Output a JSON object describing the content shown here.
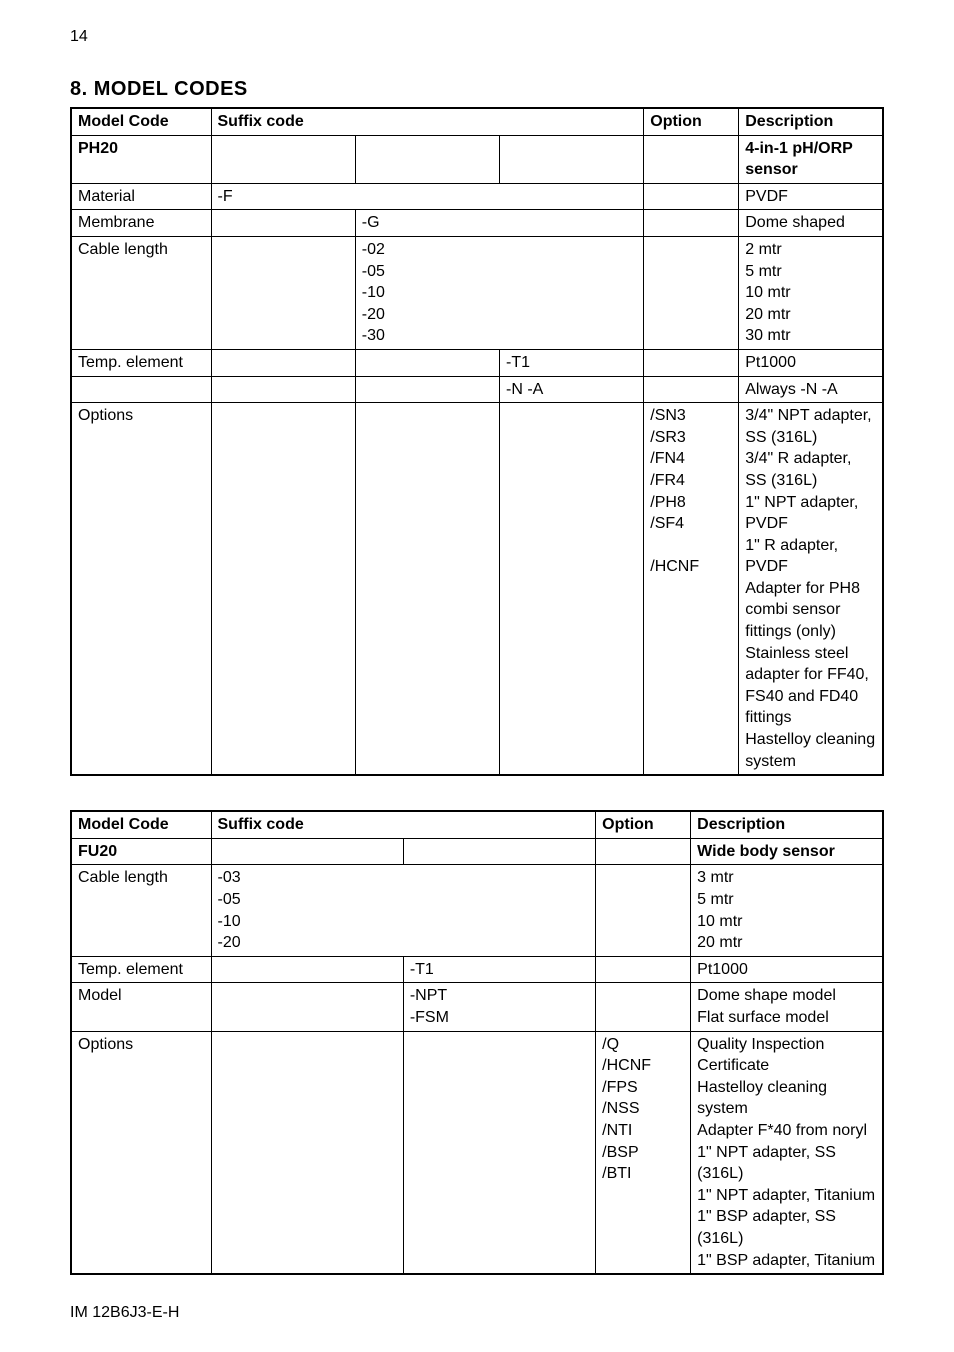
{
  "page_number": "14",
  "section_title": "8. MODEL CODES",
  "footer": "IM 12B6J3-E-H",
  "table1": {
    "headers": {
      "model_code": "Model Code",
      "suffix_code": "Suffix code",
      "option": "Option",
      "description": "Description"
    },
    "row_ph20": {
      "code": "PH20",
      "desc": "4-in-1 pH/ORP sensor"
    },
    "row_material": {
      "label": "Material",
      "suffix": "-F",
      "desc": "PVDF"
    },
    "row_membrane": {
      "label": "Membrane",
      "suffix": "-G",
      "desc": "Dome shaped"
    },
    "row_cable": {
      "label": "Cable length",
      "suffix": "-02\n-05\n-10\n-20\n-30",
      "desc": "2 mtr\n5 mtr\n10 mtr\n20 mtr\n30 mtr"
    },
    "row_temp": {
      "label": "Temp. element",
      "suffix": "-T1",
      "desc": "Pt1000"
    },
    "row_na": {
      "suffix": "-N -A",
      "desc": "Always -N -A"
    },
    "row_options": {
      "label": "Options",
      "option": "/SN3\n/SR3\n/FN4\n/FR4\n/PH8\n/SF4\n\n/HCNF",
      "desc": "3/4\" NPT adapter, SS (316L)\n3/4\" R adapter, SS (316L)\n1\" NPT adapter, PVDF\n1\" R adapter, PVDF\nAdapter for PH8 combi sensor fittings (only)\nStainless steel adapter for FF40, FS40 and FD40 fittings\nHastelloy cleaning system\n "
    }
  },
  "table2": {
    "headers": {
      "model_code": "Model Code",
      "suffix_code": "Suffix code",
      "option": "Option",
      "description": "Description"
    },
    "row_fu20": {
      "code": "FU20",
      "desc": "Wide body sensor"
    },
    "row_cable": {
      "label": "Cable length",
      "suffix": "-03\n-05\n-10\n-20",
      "desc": "3 mtr\n5 mtr\n10 mtr\n20 mtr"
    },
    "row_temp": {
      "label": "Temp. element",
      "suffix": "-T1",
      "desc": "Pt1000"
    },
    "row_model": {
      "label": "Model",
      "suffix": "-NPT\n-FSM",
      "desc": "Dome shape model\nFlat surface model"
    },
    "row_options": {
      "label": "Options",
      "option": "/Q\n/HCNF\n/FPS\n/NSS\n/NTI\n/BSP\n/BTI",
      "desc": "Quality Inspection Certificate\nHastelloy cleaning system\nAdapter F*40 from noryl\n1\" NPT adapter, SS (316L)\n1\" NPT adapter, Titanium\n1\" BSP adapter, SS (316L)\n1\" BSP adapter, Titanium\n "
    }
  }
}
